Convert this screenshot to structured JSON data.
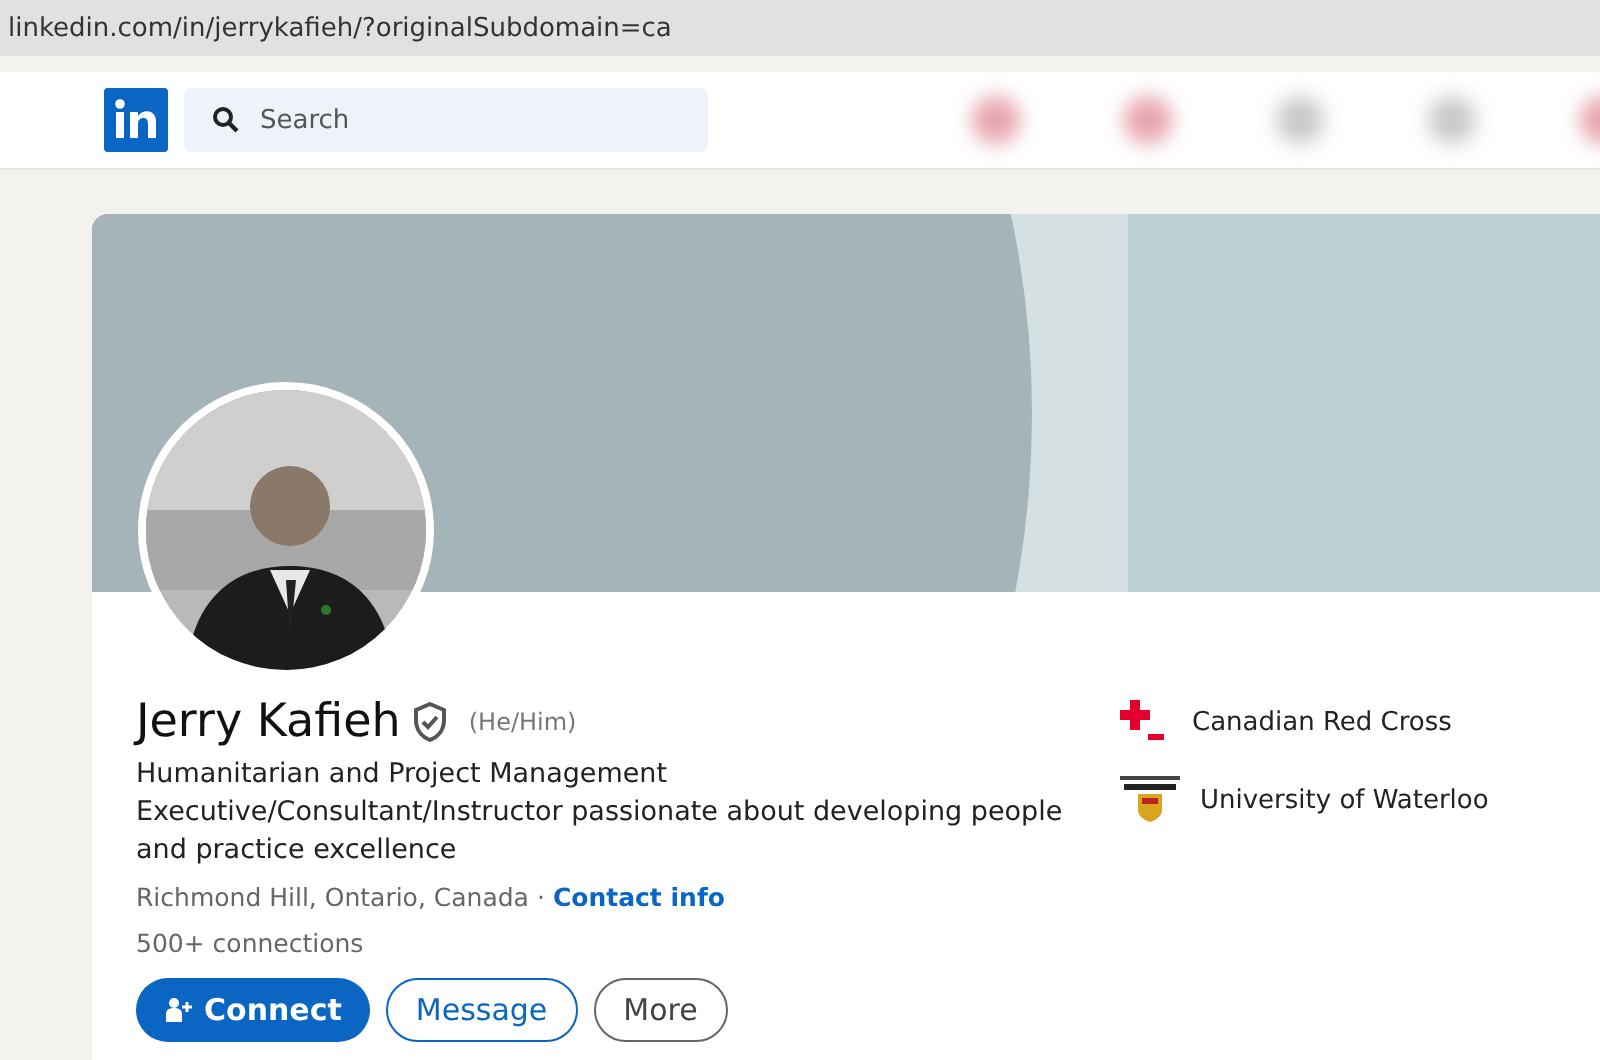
{
  "address_bar": {
    "url": "linkedin.com/in/jerrykafieh/?originalSubdomain=ca"
  },
  "nav": {
    "search": {
      "placeholder": "Search"
    }
  },
  "profile": {
    "name": "Jerry Kafieh",
    "verified": true,
    "pronouns": "(He/Him)",
    "headline": "Humanitarian and Project Management Executive/Consultant/Instructor passionate about developing people and practice excellence",
    "location": "Richmond Hill, Ontario, Canada",
    "separator": "·",
    "contact_link": "Contact info",
    "connections": "500+ connections",
    "actions": [
      {
        "label": "Connect",
        "kind": "primary"
      },
      {
        "label": "Message",
        "kind": "outline"
      },
      {
        "label": "More",
        "kind": "plain"
      }
    ],
    "organizations": [
      {
        "name": "Canadian Red Cross",
        "kind": "cross"
      },
      {
        "name": "University of Waterloo",
        "kind": "crest"
      }
    ]
  }
}
